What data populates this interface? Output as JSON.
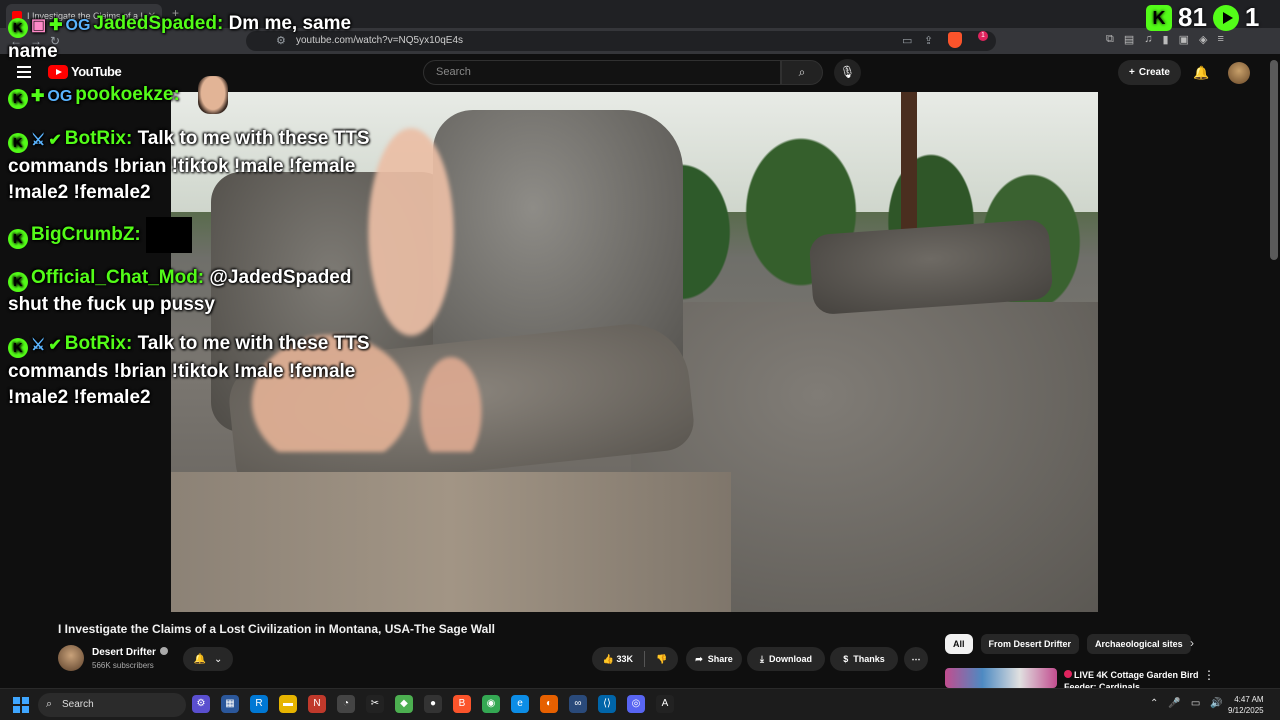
{
  "browser": {
    "tab_title": "I Investigate the Claims of a L",
    "tab_close": "✕",
    "new_tab": "+",
    "url": "youtube.com/watch?v=NQ5yx10qE4s",
    "back": "←",
    "forward": "→",
    "reload": "↻",
    "shield_badge": "1"
  },
  "youtube": {
    "logo_text": "YouTube",
    "search_placeholder": "Search",
    "create_label": "Create"
  },
  "stream_overlay": {
    "counter_left": "81",
    "counter_right": "1",
    "chat": [
      {
        "badges": [
          "gift-badge",
          "diamond-badge",
          "og-badge"
        ],
        "user": "JadedSpaded:",
        "text": " Dm me, same",
        "line2": "name"
      },
      {
        "badges": [
          "diamond-badge",
          "og-badge"
        ],
        "user": "pookoekze:",
        "text": ""
      },
      {
        "badges": [
          "sword-badge",
          "verified-badge"
        ],
        "user": "BotRix:",
        "text": " Talk to me with these TTS",
        "line2": "commands !brian !tiktok !male !female",
        "line3": "!male2 !female2"
      },
      {
        "badges": [],
        "user": "BigCrumbZ:",
        "text": ""
      },
      {
        "badges": [],
        "user": "Official_Chat_Mod:",
        "text": " @JadedSpaded",
        "line2": "shut the fuck up pussy"
      },
      {
        "badges": [
          "sword-badge",
          "verified-badge"
        ],
        "user": "BotRix:",
        "text": " Talk to me with these TTS",
        "line2": "commands !brian !tiktok !male !female",
        "line3": "!male2 !female2"
      }
    ]
  },
  "video": {
    "title": "I Investigate the Claims of a Lost Civilization in Montana, USA-The Sage Wall",
    "channel": "Desert Drifter",
    "subscribers": "566K subscribers",
    "likes": "33K",
    "share_label": "Share",
    "download_label": "Download",
    "thanks_label": "Thanks"
  },
  "sidebar": {
    "chips": [
      "All",
      "From Desert Drifter",
      "Archaeological sites"
    ],
    "rec_title_line1": "LIVE 4K Cottage Garden Bird",
    "rec_title_line2": "Feeder: Cardinals,"
  },
  "taskbar": {
    "search_label": "Search",
    "time": "4:47 AM",
    "date": "9/12/2025"
  },
  "colors": {
    "kick_green": "#53fc18",
    "youtube_red": "#ff0000",
    "background": "#0f0f0f"
  }
}
